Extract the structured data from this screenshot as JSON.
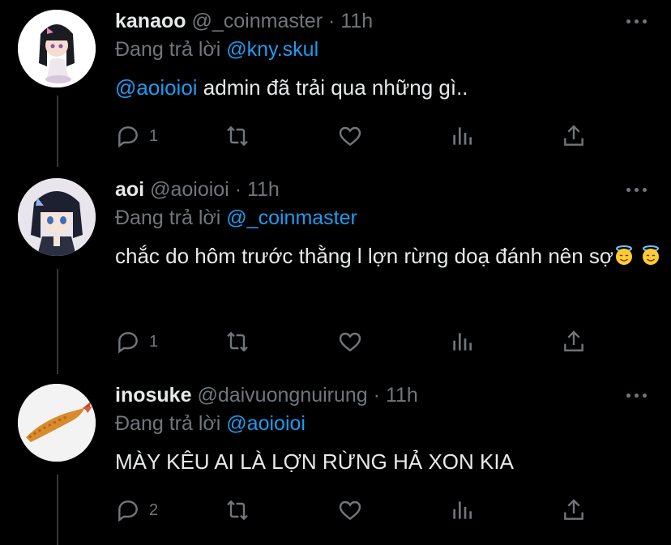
{
  "tweets": [
    {
      "name": "kanaoo",
      "handle": "@_coinmaster",
      "dot": "·",
      "time": "11h",
      "reply_prefix": "Đang trả lời",
      "reply_to": "@kny.skul",
      "mention": "@aoioioi",
      "text": " admin đã trải qua những gì..",
      "reply_count": "1",
      "avatar_icon": "anime-girl-kanao-avatar"
    },
    {
      "name": "aoi",
      "handle": "@aoioioi",
      "dot": "·",
      "time": "11h",
      "reply_prefix": "Đang trả lời",
      "reply_to": "@_coinmaster",
      "text": "chắc do hôm trước thằng l lợn rừng doạ đánh nên sợ",
      "emojis": [
        "smiling-face-with-halo",
        "smiling-face-with-halo"
      ],
      "reply_count": "1",
      "avatar_icon": "anime-girl-aoi-avatar"
    },
    {
      "name": "inosuke",
      "handle": "@daivuongnuirung",
      "dot": "·",
      "time": "11h",
      "reply_prefix": "Đang trả lời",
      "reply_to": "@aoioioi",
      "text": "MÀY KÊU AI LÀ LỢN RỪNG HẢ XON KIA",
      "reply_count": "2",
      "avatar_icon": "fried-shrimp-avatar"
    }
  ],
  "colors": {
    "background": "#000000",
    "text": "#e7e9ea",
    "muted": "#71767b",
    "link": "#1d9bf0"
  }
}
